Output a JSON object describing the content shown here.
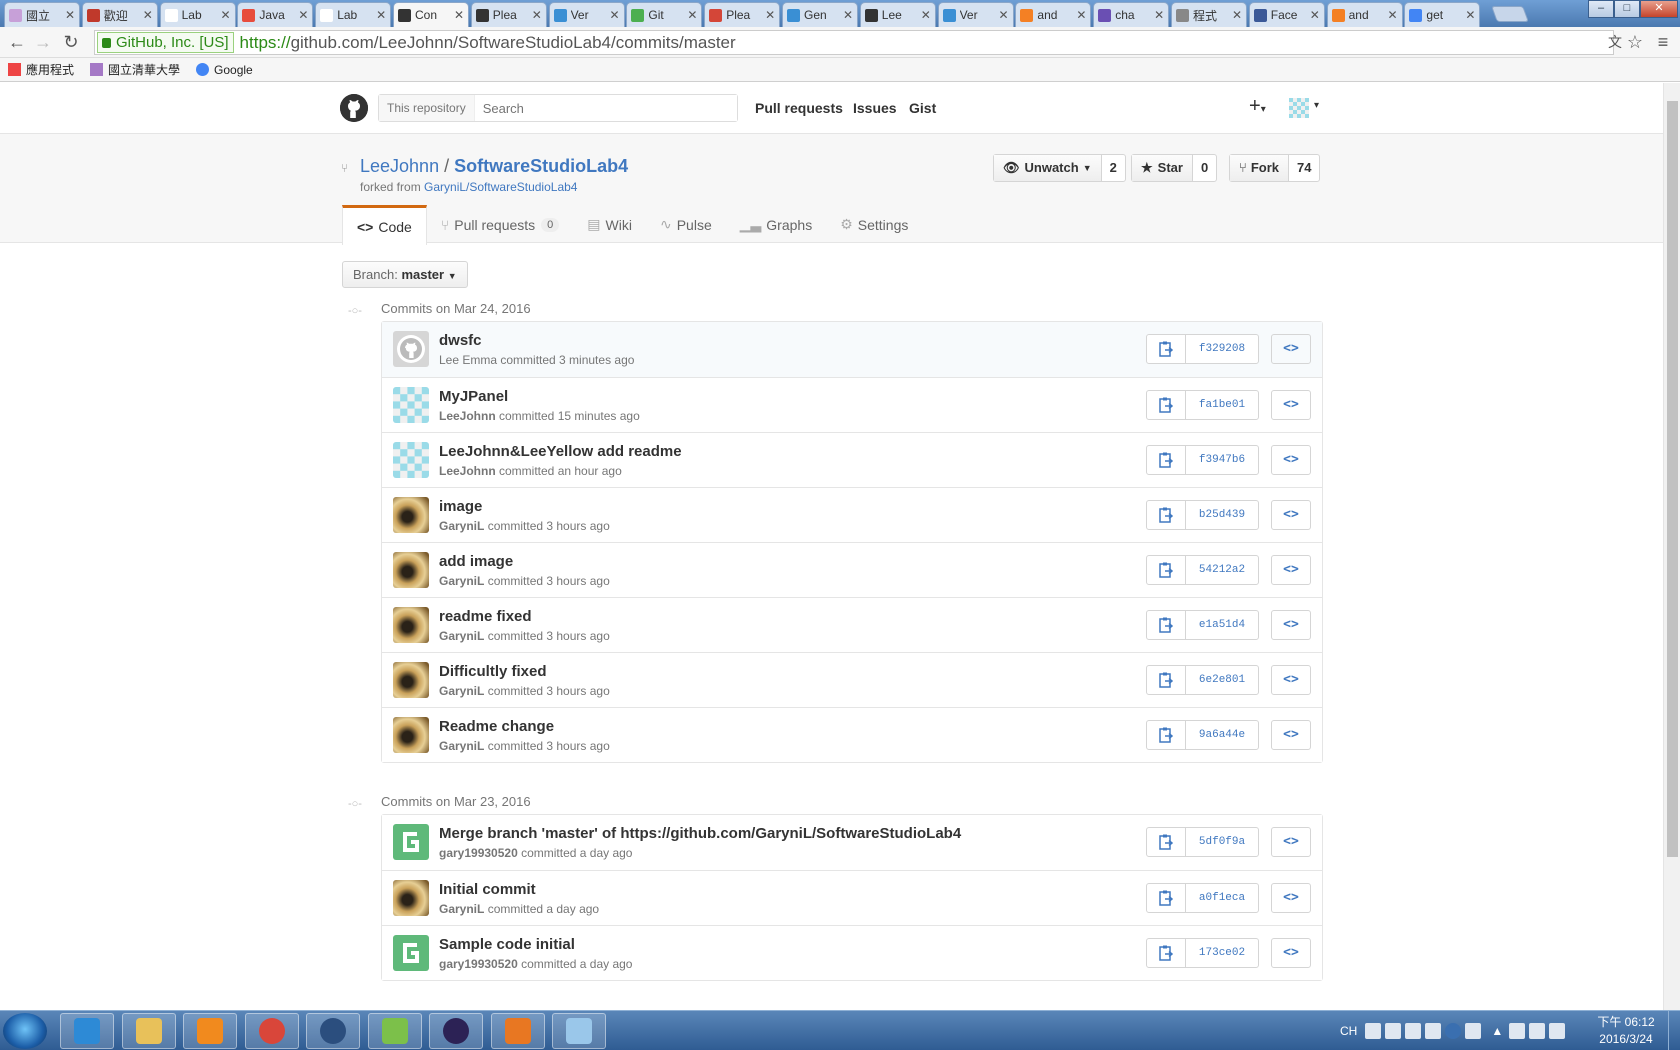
{
  "browser": {
    "tabs": [
      {
        "label": "國立",
        "color": "#c7a0d8"
      },
      {
        "label": "歡迎",
        "color": "#c0392b"
      },
      {
        "label": "Lab",
        "color": "#ffffff"
      },
      {
        "label": "Java",
        "color": "#e74c3c"
      },
      {
        "label": "Lab",
        "color": "#ffffff"
      },
      {
        "label": "Con",
        "color": "#333333"
      },
      {
        "label": "Plea",
        "color": "#333333"
      },
      {
        "label": "Ver",
        "color": "#3a8fd4"
      },
      {
        "label": "Git",
        "color": "#4caf50"
      },
      {
        "label": "Plea",
        "color": "#d44638"
      },
      {
        "label": "Gen",
        "color": "#3a8fd4"
      },
      {
        "label": "Lee",
        "color": "#333333"
      },
      {
        "label": "Ver",
        "color": "#3a8fd4"
      },
      {
        "label": "and",
        "color": "#f48024"
      },
      {
        "label": "cha",
        "color": "#6a4fb3"
      },
      {
        "label": "程式",
        "color": "#888888"
      },
      {
        "label": "Face",
        "color": "#3b5998"
      },
      {
        "label": "and",
        "color": "#f48024"
      },
      {
        "label": "get",
        "color": "#4285f4"
      }
    ],
    "active_tab_index": 5,
    "ev_label": "GitHub, Inc. [US]",
    "url_scheme": "https://",
    "url_host": "github.com",
    "url_path": "/LeeJohnn/SoftwareStudioLab4/commits/master",
    "bookmarks": [
      {
        "label": "應用程式",
        "icon": "apps-grid-icon"
      },
      {
        "label": "國立清華大學",
        "icon": "nthu-icon"
      },
      {
        "label": "Google",
        "icon": "google-icon"
      }
    ]
  },
  "header": {
    "search_scope": "This repository",
    "search_placeholder": "Search",
    "nav": [
      "Pull requests",
      "Issues",
      "Gist"
    ]
  },
  "repo": {
    "owner": "LeeJohnn",
    "separator": "/",
    "name": "SoftwareStudioLab4",
    "forked_prefix": "forked from",
    "forked_from": "GaryniL/SoftwareStudioLab4",
    "watch_label": "Unwatch",
    "watch_count": "2",
    "star_label": "Star",
    "star_count": "0",
    "fork_label": "Fork",
    "fork_count": "74",
    "tabs": [
      {
        "label": "Code",
        "icon": "code-icon"
      },
      {
        "label": "Pull requests",
        "icon": "pull-request-icon",
        "count": "0"
      },
      {
        "label": "Wiki",
        "icon": "book-icon"
      },
      {
        "label": "Pulse",
        "icon": "pulse-icon"
      },
      {
        "label": "Graphs",
        "icon": "graph-icon"
      },
      {
        "label": "Settings",
        "icon": "gear-icon"
      }
    ],
    "branch_prefix": "Branch:",
    "branch": "master"
  },
  "commit_groups": [
    {
      "title": "Commits on Mar 24, 2016",
      "commits": [
        {
          "message": "dwsfc",
          "author": "",
          "meta": "Lee Emma committed 3 minutes ago",
          "sha": "f329208",
          "avatar": "default"
        },
        {
          "message": "MyJPanel",
          "author": "LeeJohnn",
          "meta": " committed 15 minutes ago",
          "sha": "fa1be01",
          "avatar": "identicon"
        },
        {
          "message": "LeeJohnn&LeeYellow add readme",
          "author": "LeeJohnn",
          "meta": " committed an hour ago",
          "sha": "f3947b6",
          "avatar": "identicon"
        },
        {
          "message": "image",
          "author": "GaryniL",
          "meta": " committed 3 hours ago",
          "sha": "b25d439",
          "avatar": "photo"
        },
        {
          "message": "add image",
          "author": "GaryniL",
          "meta": " committed 3 hours ago",
          "sha": "54212a2",
          "avatar": "photo"
        },
        {
          "message": "readme fixed",
          "author": "GaryniL",
          "meta": " committed 3 hours ago",
          "sha": "e1a51d4",
          "avatar": "photo"
        },
        {
          "message": "Difficultly fixed",
          "author": "GaryniL",
          "meta": " committed 3 hours ago",
          "sha": "6e2e801",
          "avatar": "photo"
        },
        {
          "message": "Readme change",
          "author": "GaryniL",
          "meta": " committed 3 hours ago",
          "sha": "9a6a44e",
          "avatar": "photo"
        }
      ]
    },
    {
      "title": "Commits on Mar 23, 2016",
      "commits": [
        {
          "message": "Merge branch 'master' of https://github.com/GaryniL/SoftwareStudioLab4",
          "author": "gary19930520",
          "meta": " committed a day ago",
          "sha": "5df0f9a",
          "avatar": "green-g"
        },
        {
          "message": "Initial commit",
          "author": "GaryniL",
          "meta": " committed a day ago",
          "sha": "a0f1eca",
          "avatar": "photo"
        },
        {
          "message": "Sample code initial",
          "author": "gary19930520",
          "meta": " committed a day ago",
          "sha": "173ce02",
          "avatar": "green-g"
        }
      ]
    }
  ],
  "taskbar": {
    "apps": [
      "internet-explorer-icon",
      "file-explorer-icon",
      "media-player-icon",
      "chrome-icon",
      "sourcetree-icon",
      "notepad-plus-icon",
      "eclipse-icon",
      "java-icon",
      "paint-icon"
    ],
    "tray_lang": "CH",
    "clock_time": "下午 06:12",
    "clock_date": "2016/3/24"
  },
  "colors": {
    "link": "#4078c0",
    "ev_green": "#2c8a17",
    "tab_accent": "#d26911"
  }
}
